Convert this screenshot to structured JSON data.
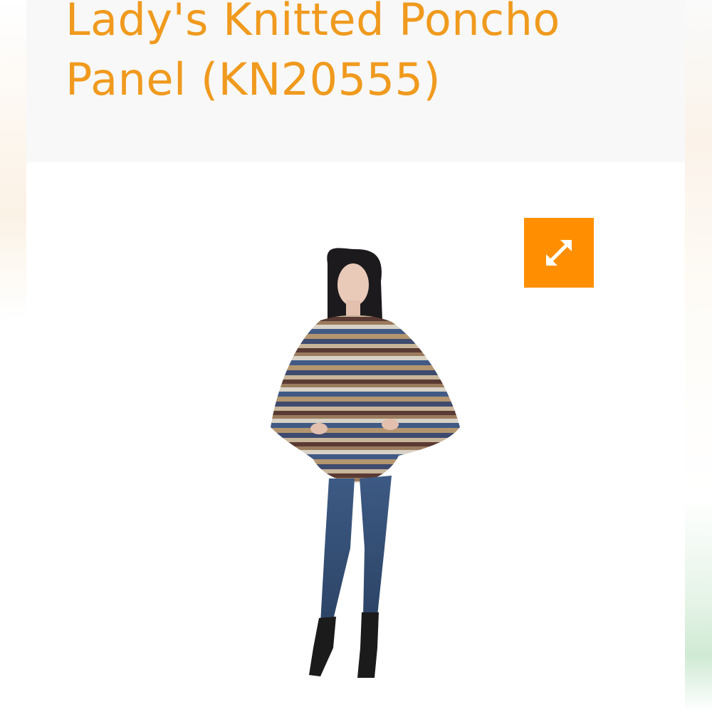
{
  "product": {
    "title": "Lady's Knitted Poncho Panel (KN20555)"
  },
  "image": {
    "alt": "Woman wearing a striped knitted poncho with jeans and black boots"
  },
  "expand_button": {
    "icon": "expand-arrows-icon",
    "aria_label": "Enlarge image"
  },
  "colors": {
    "accent": "#ff8f00",
    "title": "#f09a1e"
  }
}
